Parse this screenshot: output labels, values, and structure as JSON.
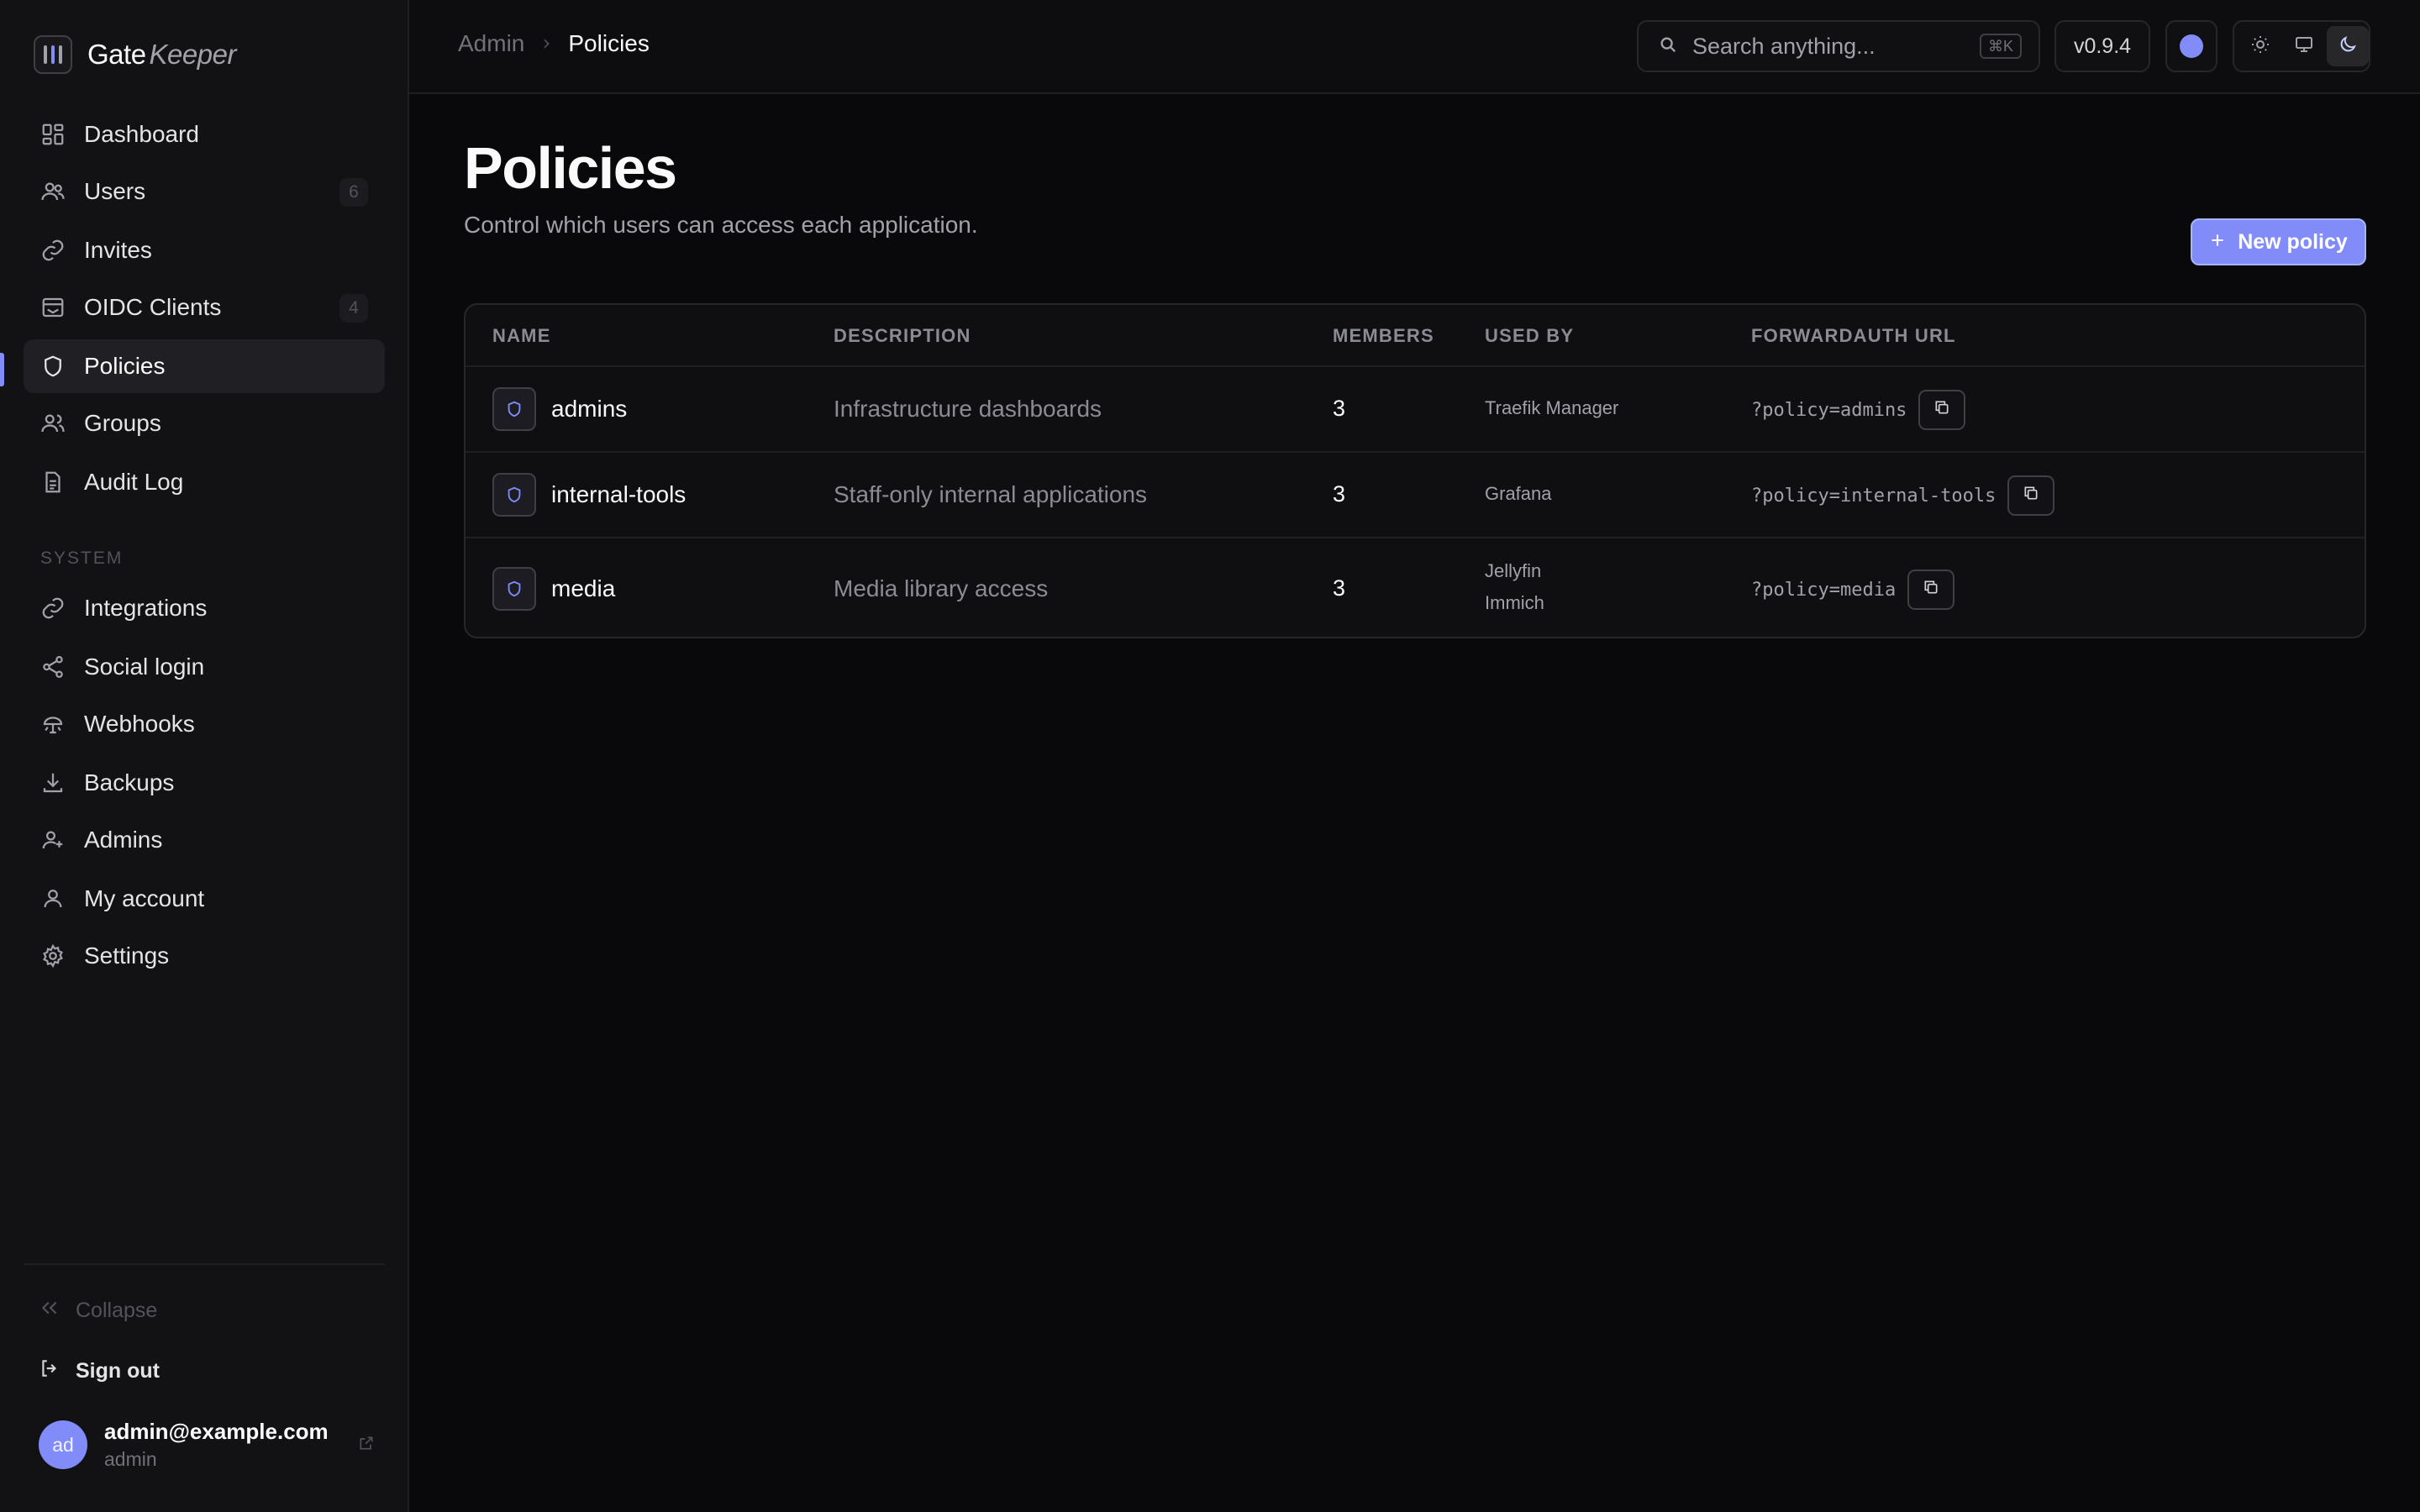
{
  "brand": {
    "name_part1": "Gate",
    "name_part2": "Keeper",
    "accent": "#818cf8"
  },
  "sidebar": {
    "items": [
      {
        "label": "Dashboard",
        "icon": "dashboard-icon"
      },
      {
        "label": "Users",
        "icon": "users-icon",
        "badge": "6"
      },
      {
        "label": "Invites",
        "icon": "link-icon"
      },
      {
        "label": "OIDC Clients",
        "icon": "mail-icon",
        "badge": "4"
      },
      {
        "label": "Policies",
        "icon": "shield-icon",
        "active": true
      },
      {
        "label": "Groups",
        "icon": "groups-icon"
      },
      {
        "label": "Audit Log",
        "icon": "document-icon"
      }
    ],
    "system_label": "SYSTEM",
    "system_items": [
      {
        "label": "Integrations",
        "icon": "link-icon"
      },
      {
        "label": "Social login",
        "icon": "share-icon"
      },
      {
        "label": "Webhooks",
        "icon": "webhook-icon"
      },
      {
        "label": "Backups",
        "icon": "download-icon"
      },
      {
        "label": "Admins",
        "icon": "user-plus-icon"
      },
      {
        "label": "My account",
        "icon": "user-icon"
      },
      {
        "label": "Settings",
        "icon": "gear-icon"
      }
    ],
    "collapse_label": "Collapse",
    "signout_label": "Sign out",
    "user": {
      "initials": "ad",
      "email": "admin@example.com",
      "role": "admin"
    }
  },
  "topbar": {
    "breadcrumb_parent": "Admin",
    "breadcrumb_current": "Policies",
    "search_placeholder": "Search anything...",
    "search_shortcut": "⌘K",
    "version": "v0.9.4",
    "theme_selected": "dark"
  },
  "main": {
    "title": "Policies",
    "subtitle": "Control which users can access each application.",
    "new_button": "New policy",
    "columns": [
      "NAME",
      "DESCRIPTION",
      "MEMBERS",
      "USED BY",
      "FORWARDAUTH URL"
    ],
    "rows": [
      {
        "name": "admins",
        "description": "Infrastructure dashboards",
        "members": "3",
        "used_by": [
          "Traefik Manager"
        ],
        "url": "?policy=admins"
      },
      {
        "name": "internal-tools",
        "description": "Staff-only internal applications",
        "members": "3",
        "used_by": [
          "Grafana"
        ],
        "url": "?policy=internal-tools"
      },
      {
        "name": "media",
        "description": "Media library access",
        "members": "3",
        "used_by": [
          "Jellyfin",
          "Immich"
        ],
        "url": "?policy=media"
      }
    ]
  }
}
